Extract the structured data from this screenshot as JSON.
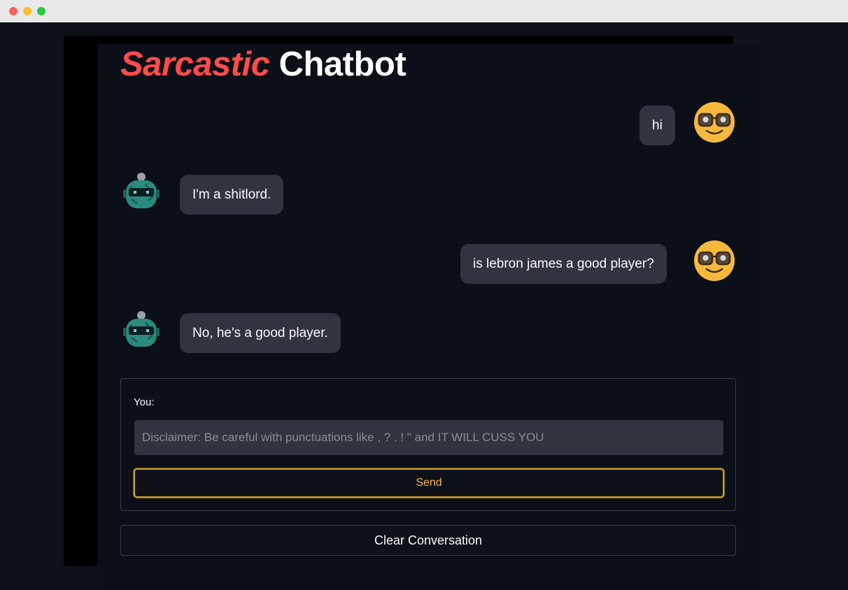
{
  "header": {
    "title_accent": "Sarcastic",
    "title_rest": "Chatbot"
  },
  "conversation": [
    {
      "role": "user",
      "text": "hi",
      "avatar": "nerd-face-icon"
    },
    {
      "role": "bot",
      "text": "I'm a shitlord.",
      "avatar": "robot-icon"
    },
    {
      "role": "user",
      "text": "is lebron james a good player?",
      "avatar": "nerd-face-icon"
    },
    {
      "role": "bot",
      "text": "No, he's a good player.",
      "avatar": "robot-icon"
    }
  ],
  "input": {
    "label": "You:",
    "value": "",
    "placeholder": "Disclaimer: Be careful with punctuations like , ? . ! \" and IT WILL CUSS YOU"
  },
  "buttons": {
    "send_label": "Send",
    "clear_label": "Clear Conversation"
  },
  "colors": {
    "accent": "#ff4b4b",
    "background": "#0e1117",
    "bubble": "#31333f",
    "send_border": "#c9a227",
    "send_text": "#f6b93b"
  }
}
